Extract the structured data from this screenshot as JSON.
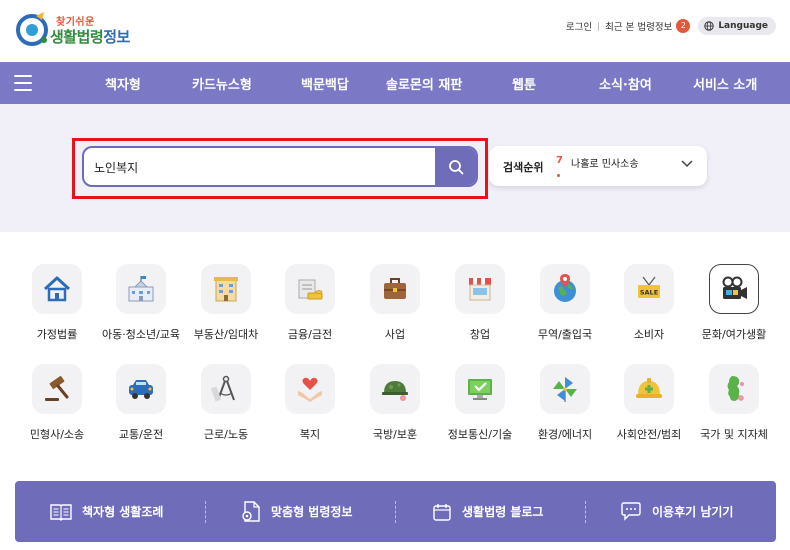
{
  "header": {
    "logo_small": "찾기쉬운",
    "logo_big_a": "생활법령",
    "logo_big_b": "정보",
    "login": "로그인",
    "recent": "최근 본 법령정보",
    "recent_count": "2",
    "language": "Language"
  },
  "nav": {
    "items": [
      "책자형",
      "카드뉴스형",
      "백문백답",
      "솔로몬의 재판",
      "웹툰",
      "소식·참여",
      "서비스 소개"
    ]
  },
  "search": {
    "value": "노인복지",
    "rank_title": "검색순위",
    "rank_number": "7",
    "rank_text": "나홀로 민사소송"
  },
  "categories": [
    {
      "label": "가정법률",
      "icon": "house-icon"
    },
    {
      "label": "아동·청소년/교육",
      "icon": "school-icon"
    },
    {
      "label": "부동산/임대차",
      "icon": "building-icon"
    },
    {
      "label": "금융/금전",
      "icon": "money-icon"
    },
    {
      "label": "사업",
      "icon": "briefcase-icon"
    },
    {
      "label": "창업",
      "icon": "store-icon"
    },
    {
      "label": "무역/출입국",
      "icon": "globe-icon"
    },
    {
      "label": "소비자",
      "icon": "sale-icon"
    },
    {
      "label": "문화/여가생활",
      "icon": "film-camera-icon"
    },
    {
      "label": "민형사/소송",
      "icon": "gavel-icon"
    },
    {
      "label": "교통/운전",
      "icon": "car-icon"
    },
    {
      "label": "근로/노동",
      "icon": "compass-icon"
    },
    {
      "label": "복지",
      "icon": "heart-hands-icon"
    },
    {
      "label": "국방/보훈",
      "icon": "helmet-icon"
    },
    {
      "label": "정보통신/기술",
      "icon": "monitor-icon"
    },
    {
      "label": "환경/에너지",
      "icon": "pinwheel-icon"
    },
    {
      "label": "사회안전/범죄",
      "icon": "safety-helmet-icon"
    },
    {
      "label": "국가 및 지자체",
      "icon": "korea-map-icon"
    }
  ],
  "bottom_bar": {
    "items": [
      "책자형 생활조례",
      "맞춤형 법령정보",
      "생활법령 블로그",
      "이용후기 남기기"
    ]
  },
  "colors": {
    "nav": "#7b79c5",
    "accent": "#6f6db9",
    "search_band": "#f1f0f9",
    "highlight": "#e8131a"
  }
}
